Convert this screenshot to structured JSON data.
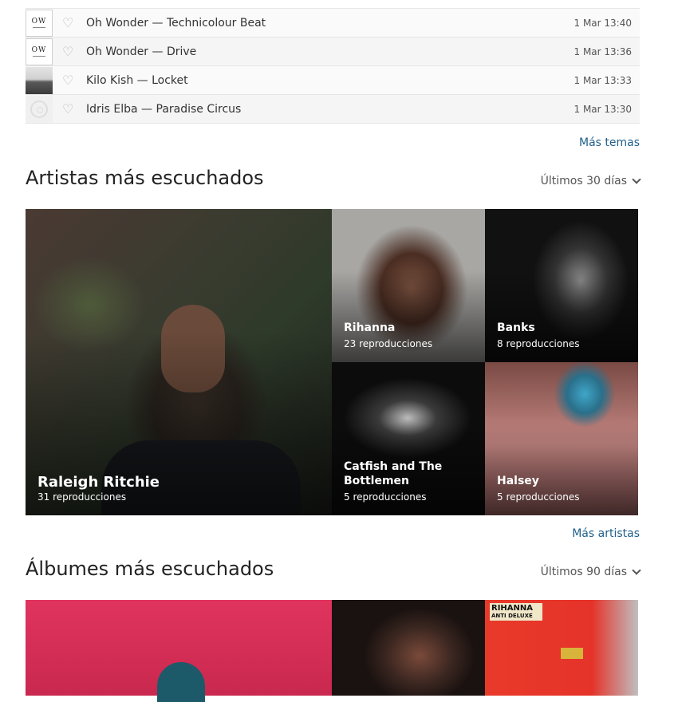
{
  "tracks": [
    {
      "title": "Oh Wonder — Technicolour Beat",
      "time": "1 Mar 13:40",
      "thumb": "OW"
    },
    {
      "title": "Oh Wonder — Drive",
      "time": "1 Mar 13:36",
      "thumb": "OW"
    },
    {
      "title": "Kilo Kish — Locket",
      "time": "1 Mar 13:33"
    },
    {
      "title": "Idris Elba — Paradise Circus",
      "time": "1 Mar 13:30"
    }
  ],
  "more_tracks_label": "Más temas",
  "artists_section": {
    "title": "Artistas más escuchados",
    "range": "Últimos 30 días",
    "items": [
      {
        "name": "Raleigh Ritchie",
        "plays": "31 reproducciones"
      },
      {
        "name": "Rihanna",
        "plays": "23 reproducciones"
      },
      {
        "name": "Banks",
        "plays": "8 reproducciones"
      },
      {
        "name": "Catfish and The Bottlemen",
        "plays": "5 reproducciones"
      },
      {
        "name": "Halsey",
        "plays": "5 reproducciones"
      }
    ],
    "more_label": "Más artistas"
  },
  "albums_section": {
    "title": "Álbumes más escuchados",
    "range": "Últimos 90 días",
    "cover_text": {
      "artist": "RIHANNA",
      "line": "ANTI DELUXE"
    }
  },
  "colors": {
    "link": "#1f5f8a",
    "heart": "#b9b9b9"
  },
  "icons": {
    "heart": "heart-outline-icon",
    "chevron": "chevron-down-icon"
  }
}
